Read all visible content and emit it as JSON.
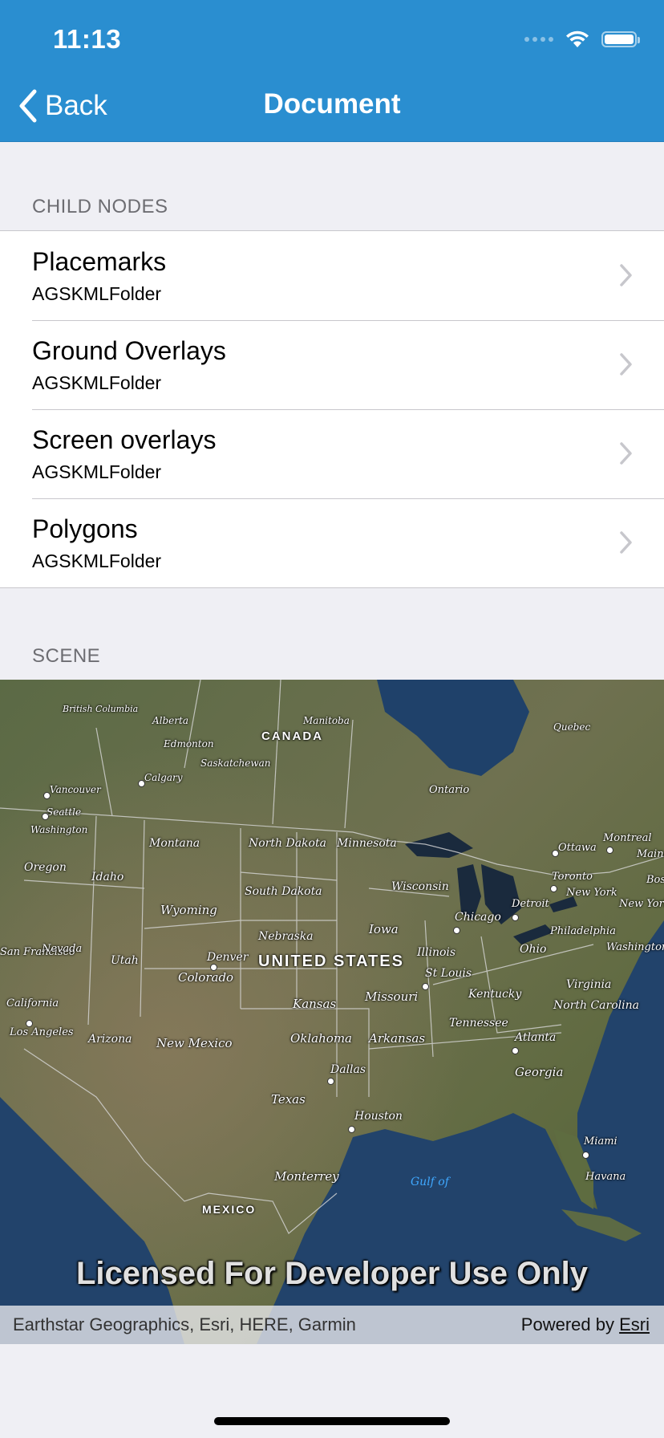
{
  "status_bar": {
    "time": "11:13"
  },
  "nav": {
    "back_label": "Back",
    "title": "Document"
  },
  "sections": {
    "child_nodes": {
      "header": "CHILD NODES",
      "rows": [
        {
          "title": "Placemarks",
          "subtitle": "AGSKMLFolder"
        },
        {
          "title": "Ground Overlays",
          "subtitle": "AGSKMLFolder"
        },
        {
          "title": "Screen overlays",
          "subtitle": "AGSKMLFolder"
        },
        {
          "title": "Polygons",
          "subtitle": "AGSKMLFolder"
        }
      ]
    },
    "scene": {
      "header": "SCENE"
    }
  },
  "map": {
    "labels": {
      "canada": "CANADA",
      "united_states": "UNITED STATES",
      "mexico": "MEXICO",
      "british_columbia": "British Columbia",
      "alberta": "Alberta",
      "manitoba": "Manitoba",
      "quebec": "Quebec",
      "edmonton": "Edmonton",
      "saskatchewan": "Saskatchewan",
      "calgary": "Calgary",
      "ontario": "Ontario",
      "vancouver": "Vancouver",
      "seattle": "Seattle",
      "washington": "Washington",
      "montana": "Montana",
      "north_dakota": "North Dakota",
      "minnesota": "Minnesota",
      "ottawa": "Ottawa",
      "montreal": "Montreal",
      "oregon": "Oregon",
      "idaho": "Idaho",
      "south_dakota": "South Dakota",
      "wisconsin": "Wisconsin",
      "toronto": "Toronto",
      "new_york_state": "New York",
      "wyoming": "Wyoming",
      "detroit": "Detroit",
      "chicago": "Chicago",
      "new_york_city": "New York",
      "nebraska": "Nebraska",
      "iowa": "Iowa",
      "philadelphia": "Philadelphia",
      "san_francisco": "San Francisco",
      "nevada": "Nevada",
      "utah": "Utah",
      "denver": "Denver",
      "colorado": "Colorado",
      "illinois": "Illinois",
      "ohio": "Ohio",
      "washington_dc": "Washington",
      "st_louis": "St Louis",
      "kansas": "Kansas",
      "missouri": "Missouri",
      "kentucky": "Kentucky",
      "virginia": "Virginia",
      "california": "California",
      "north_carolina": "North Carolina",
      "los_angeles": "Los Angeles",
      "arizona": "Arizona",
      "new_mexico": "New Mexico",
      "oklahoma": "Oklahoma",
      "arkansas": "Arkansas",
      "tennessee": "Tennessee",
      "atlanta": "Atlanta",
      "dallas": "Dallas",
      "georgia": "Georgia",
      "texas": "Texas",
      "houston": "Houston",
      "miami": "Miami",
      "monterrey": "Monterrey",
      "gulf": "Gulf of",
      "havana": "Havana",
      "boston": "Bost",
      "maine": "Maine"
    },
    "license_text": "Licensed For Developer Use Only",
    "attribution": "Earthstar Geographics, Esri, HERE, Garmin",
    "powered_by": "Powered by",
    "powered_by_link": "Esri"
  },
  "colors": {
    "nav_bar": "#2a8ed0",
    "background": "#efeff4",
    "separator": "#c8c7cc",
    "section_header": "#6d6d72"
  },
  "icons": {
    "back": "chevron-left-icon",
    "disclosure": "chevron-right-icon",
    "wifi": "wifi-icon",
    "battery": "battery-icon",
    "signal": "cellular-signal-icon"
  }
}
